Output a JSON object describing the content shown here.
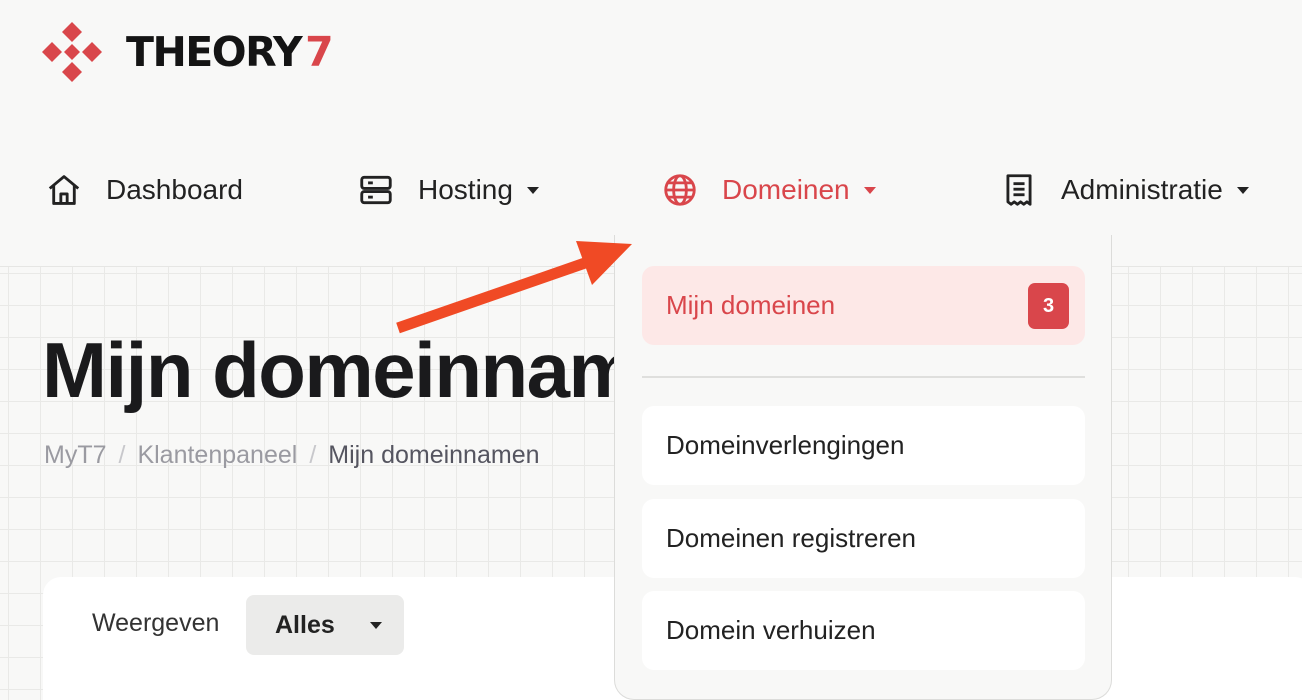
{
  "brand": {
    "name": "THEORY",
    "number": "7",
    "accent": "#d9464b"
  },
  "nav": {
    "items": [
      {
        "label": "Dashboard",
        "icon": "home-icon"
      },
      {
        "label": "Hosting",
        "icon": "server-icon"
      },
      {
        "label": "Domeinen",
        "icon": "globe-icon",
        "active": true
      },
      {
        "label": "Administratie",
        "icon": "receipt-icon"
      }
    ]
  },
  "dropdown": {
    "items": [
      {
        "label": "Mijn domeinen",
        "badge": "3",
        "active": true
      },
      {
        "label": "Domeinverlengingen"
      },
      {
        "label": "Domeinen registreren"
      },
      {
        "label": "Domein verhuizen"
      }
    ]
  },
  "page": {
    "title": "Mijn domeinnamen",
    "breadcrumb": [
      "MyT7",
      "Klantenpaneel",
      "Mijn domeinnamen"
    ],
    "separator": "/"
  },
  "filter": {
    "label": "Weergeven",
    "value": "Alles"
  }
}
